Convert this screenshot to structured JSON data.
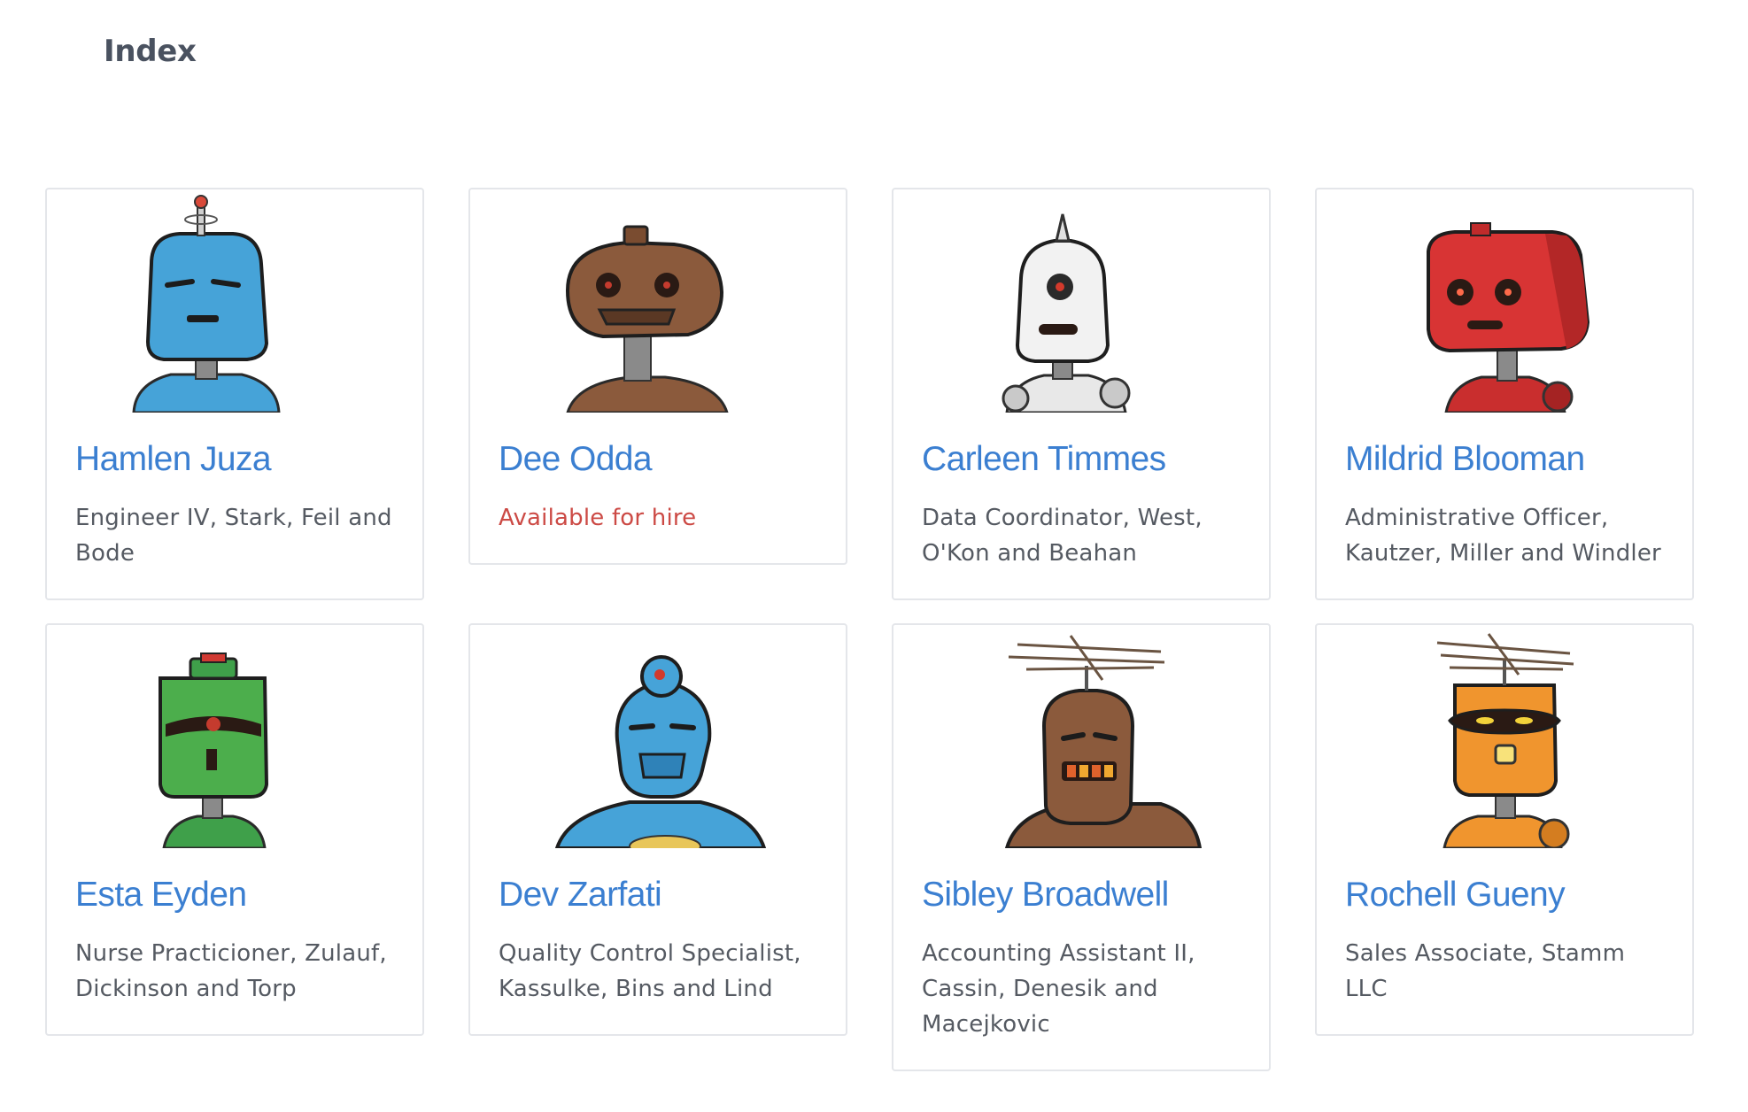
{
  "page": {
    "title": "Index"
  },
  "colors": {
    "link": "#3b7fd1",
    "text": "#555a62",
    "hire": "#cc4a45",
    "border": "#e4e6ea"
  },
  "cards": [
    {
      "name": "Hamlen Juza",
      "subtitle": "Engineer IV, Stark, Feil and Bode",
      "robot": "blue-antenna-robot-icon"
    },
    {
      "name": "Dee Odda",
      "subtitle": "Available for hire",
      "robot": "brown-dome-robot-icon"
    },
    {
      "name": "Carleen Timmes",
      "subtitle": "Data Coordinator, West, O'Kon and Beahan",
      "robot": "white-cyclops-robot-icon"
    },
    {
      "name": "Mildrid Blooman",
      "subtitle": "Administrative Officer, Kautzer, Miller and Windler",
      "robot": "red-robot-icon"
    },
    {
      "name": "Esta Eyden",
      "subtitle": "Nurse Practicioner, Zulauf, Dickinson and Torp",
      "robot": "green-robot-icon"
    },
    {
      "name": "Dev Zarfati",
      "subtitle": "Quality Control Specialist, Kassulke, Bins and Lind",
      "robot": "blue-round-robot-icon"
    },
    {
      "name": "Sibley Broadwell",
      "subtitle": "Accounting Assistant II, Cassin, Denesik and Macejkovic",
      "robot": "brown-tv-antenna-robot-icon"
    },
    {
      "name": "Rochell Gueny",
      "subtitle": "Sales Associate, Stamm LLC",
      "robot": "orange-tv-antenna-robot-icon"
    }
  ]
}
